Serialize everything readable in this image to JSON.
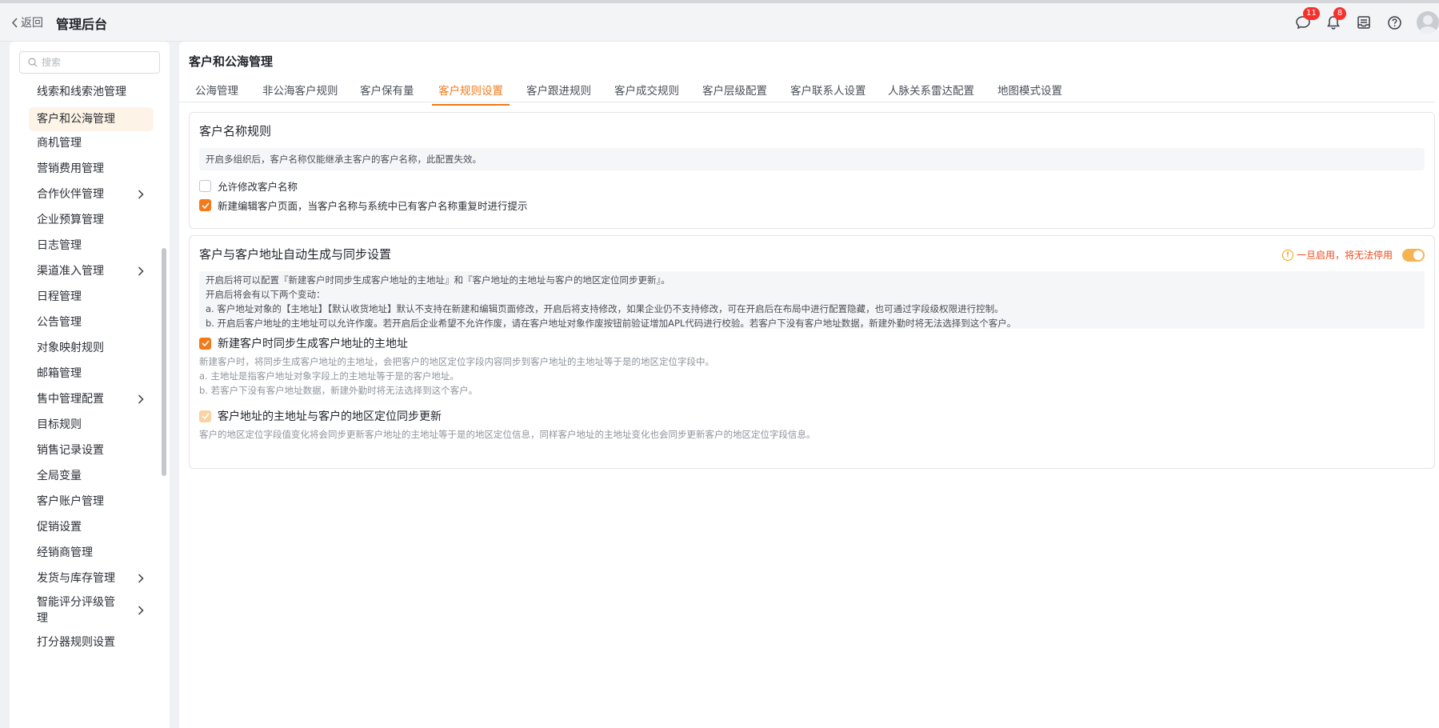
{
  "header": {
    "back_label": "返回",
    "title": "管理后台",
    "chat_badge": "11",
    "bell_badge": "8"
  },
  "sidebar": {
    "search_placeholder": "搜索",
    "items": [
      {
        "label": "线索和线索池管理",
        "has_children": false,
        "active": false
      },
      {
        "label": "客户和公海管理",
        "has_children": false,
        "active": true
      },
      {
        "label": "商机管理",
        "has_children": false,
        "active": false
      },
      {
        "label": "营销费用管理",
        "has_children": false,
        "active": false
      },
      {
        "label": "合作伙伴管理",
        "has_children": true,
        "active": false
      },
      {
        "label": "企业预算管理",
        "has_children": false,
        "active": false
      },
      {
        "label": "日志管理",
        "has_children": false,
        "active": false
      },
      {
        "label": "渠道准入管理",
        "has_children": true,
        "active": false
      },
      {
        "label": "日程管理",
        "has_children": false,
        "active": false
      },
      {
        "label": "公告管理",
        "has_children": false,
        "active": false
      },
      {
        "label": "对象映射规则",
        "has_children": false,
        "active": false
      },
      {
        "label": "邮箱管理",
        "has_children": false,
        "active": false
      },
      {
        "label": "售中管理配置",
        "has_children": true,
        "active": false
      },
      {
        "label": "目标规则",
        "has_children": false,
        "active": false
      },
      {
        "label": "销售记录设置",
        "has_children": false,
        "active": false
      },
      {
        "label": "全局变量",
        "has_children": false,
        "active": false
      },
      {
        "label": "客户账户管理",
        "has_children": false,
        "active": false
      },
      {
        "label": "促销设置",
        "has_children": false,
        "active": false
      },
      {
        "label": "经销商管理",
        "has_children": false,
        "active": false
      },
      {
        "label": "发货与库存管理",
        "has_children": true,
        "active": false
      },
      {
        "label": "智能评分评级管理",
        "has_children": true,
        "active": false
      },
      {
        "label": "打分器规则设置",
        "has_children": false,
        "active": false
      }
    ]
  },
  "main": {
    "title": "客户和公海管理",
    "tabs": [
      {
        "label": "公海管理",
        "active": false
      },
      {
        "label": "非公海客户规则",
        "active": false
      },
      {
        "label": "客户保有量",
        "active": false
      },
      {
        "label": "客户规则设置",
        "active": true
      },
      {
        "label": "客户跟进规则",
        "active": false
      },
      {
        "label": "客户成交规则",
        "active": false
      },
      {
        "label": "客户层级配置",
        "active": false
      },
      {
        "label": "客户联系人设置",
        "active": false
      },
      {
        "label": "人脉关系雷达配置",
        "active": false
      },
      {
        "label": "地图模式设置",
        "active": false
      }
    ],
    "name_rule": {
      "title": "客户名称规则",
      "notice": "开启多组织后，客户名称仅能继承主客户的客户名称，此配置失效。",
      "options": [
        {
          "label": "允许修改客户名称",
          "checked": false
        },
        {
          "label": "新建编辑客户页面，当客户名称与系统中已有客户名称重复时进行提示",
          "checked": true
        }
      ]
    },
    "address_sync": {
      "title": "客户与客户地址自动生成与同步设置",
      "warning": "一旦启用，将无法停用",
      "enabled": true,
      "notice_lines": [
        "开启后将可以配置『新建客户时同步生成客户地址的主地址』和『客户地址的主地址与客户的地区定位同步更新』。",
        "开启后将会有以下两个变动：",
        "a. 客户地址对象的【主地址】【默认收货地址】默认不支持在新建和编辑页面修改，开启后将支持修改，如果企业仍不支持修改，可在开启后在布局中进行配置隐藏，也可通过字段级权限进行控制。",
        "b. 开启后客户地址的主地址可以允许作废。若开启后企业希望不允许作废，请在客户地址对象作废按钮前验证增加APL代码进行校验。若客户下没有客户地址数据，新建外勤时将无法选择到这个客户。"
      ],
      "option1": {
        "label": "新建客户时同步生成客户地址的主地址",
        "checked": true,
        "desc_lines": [
          "新建客户时，将同步生成客户地址的主地址，会把客户的地区定位字段内容同步到客户地址的主地址等于是的地区定位字段中。",
          "a. 主地址是指客户地址对象字段上的主地址等于是的客户地址。",
          "b. 若客户下没有客户地址数据，新建外勤时将无法选择到这个客户。"
        ]
      },
      "option2": {
        "label": "客户地址的主地址与客户的地区定位同步更新",
        "checked": true,
        "disabled": true,
        "desc": "客户的地区定位字段值变化将会同步更新客户地址的主地址等于是的地区定位信息，同样客户地址的主地址变化也会同步更新客户的地区定位字段信息。"
      }
    }
  }
}
